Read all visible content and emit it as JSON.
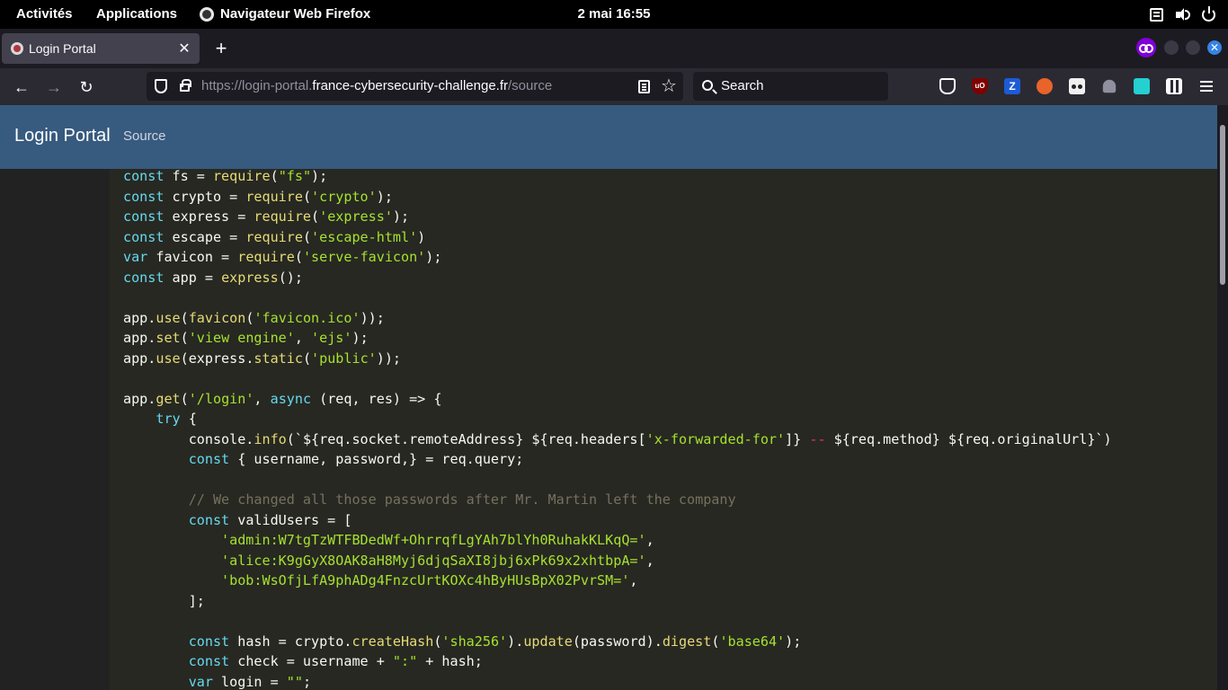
{
  "gnome_bar": {
    "activities": "Activités",
    "applications": "Applications",
    "app_menu": "Navigateur Web Firefox",
    "clock": "2 mai  16:55"
  },
  "tab": {
    "title": "Login Portal",
    "close": "✕",
    "new_tab": "+"
  },
  "window_controls": {
    "close": "✕"
  },
  "navbar": {
    "back": "←",
    "forward": "→",
    "reload": "↻",
    "url_scheme": "https://login-portal.",
    "url_domain": "france-cybersecurity-challenge.fr",
    "url_path": "/source",
    "star": "☆",
    "search_placeholder": "Search"
  },
  "extensions": {
    "ublock": "uO",
    "zotero": "Z"
  },
  "page": {
    "brand": "Login Portal",
    "nav_source": "Source"
  },
  "code_lines": [
    "const fs = require(\"fs\");",
    "const crypto = require('crypto');",
    "const express = require('express');",
    "const escape = require('escape-html')",
    "var favicon = require('serve-favicon');",
    "const app = express();",
    "",
    "app.use(favicon('favicon.ico'));",
    "app.set('view engine', 'ejs');",
    "app.use(express.static('public'));",
    "",
    "app.get('/login', async (req, res) => {",
    "    try {",
    "        console.info(`${req.socket.remoteAddress} ${req.headers['x-forwarded-for']} -- ${req.method} ${req.originalUrl}`)",
    "        const { username, password,} = req.query;",
    "",
    "        // We changed all those passwords after Mr. Martin left the company",
    "        const validUsers = [",
    "            'admin:W7tgTzWTFBDedWf+OhrrqfLgYAh7blYh0RuhakKLKqQ=',",
    "            'alice:K9gGyX8OAK8aH8Myj6djqSaXI8jbj6xPk69x2xhtbpA=',",
    "            'bob:WsOfjLfA9phADg4FnzcUrtKOXc4hByHUsBpX02PvrSM=',",
    "        ];",
    "",
    "        const hash = crypto.createHash('sha256').update(password).digest('base64');",
    "        const check = username + \":\" + hash;",
    "        var login = \"\";"
  ]
}
